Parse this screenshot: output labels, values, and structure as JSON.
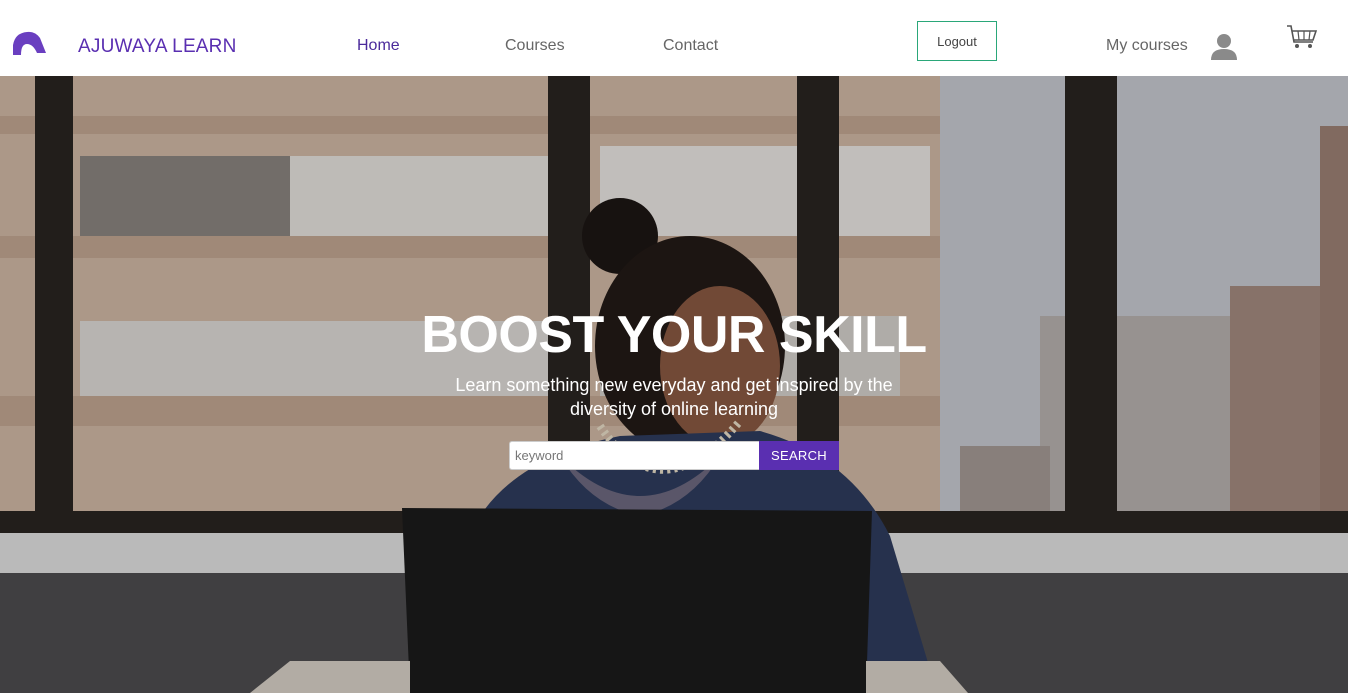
{
  "brand": {
    "name_bold": "AJUWAYA",
    "name_light": "LEARN",
    "logo_icon": "arch-logo-icon",
    "color": "#5a2fb1"
  },
  "nav": {
    "links": [
      {
        "label": "Home",
        "active": true
      },
      {
        "label": "Courses",
        "active": false
      },
      {
        "label": "Contact",
        "active": false
      }
    ],
    "logout_label": "Logout",
    "my_courses_label": "My courses",
    "avatar_icon": "user-avatar-icon",
    "cart_icon": "shopping-basket-icon"
  },
  "hero": {
    "title": "BOOST YOUR SKILL",
    "subtitle": "Learn something new everyday and get inspired by the diversity of online learning",
    "background": "woman-with-laptop-photo"
  },
  "search": {
    "placeholder": "keyword",
    "value": "",
    "button_label": "SEARCH",
    "button_color": "#5a2fb1"
  },
  "colors": {
    "accent": "#5a2fb1",
    "logout_border": "#2aa779",
    "nav_text": "#666666"
  }
}
